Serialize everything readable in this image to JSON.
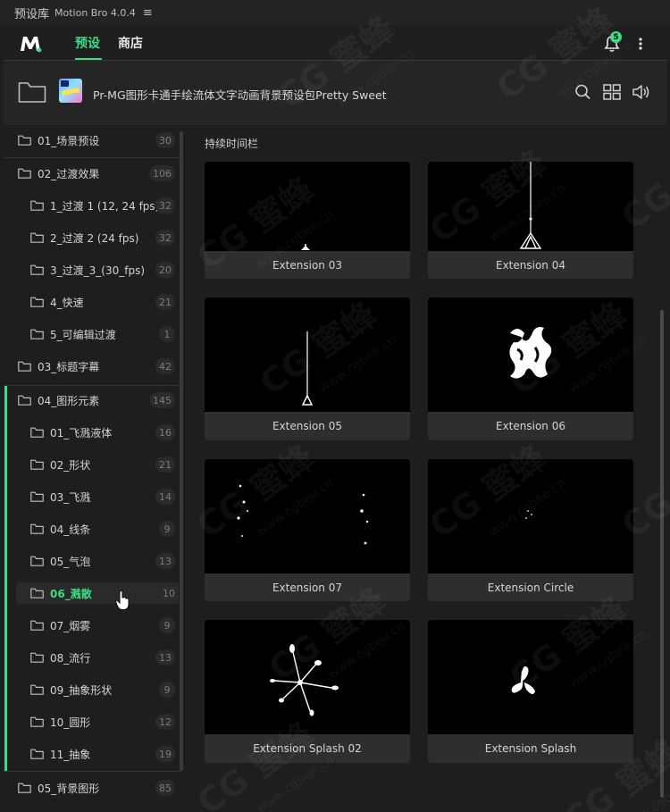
{
  "titlebar": {
    "name": "预设库",
    "version": "Motion Bro 4.0.4",
    "menu_glyph": "≡"
  },
  "header": {
    "tabs": [
      {
        "label": "预设"
      },
      {
        "label": "商店"
      }
    ],
    "notification_count": "5",
    "accent": "#3ddc84"
  },
  "pack": {
    "title": "Pr-MG图形卡通手绘流体文字动画背景预设包Pretty Sweet"
  },
  "sidebar": {
    "items": [
      {
        "label": "01_场景预设",
        "count": "30"
      },
      {
        "label": "02_过渡效果",
        "count": "106"
      },
      {
        "label": "1_过渡 1 (12, 24 fps)",
        "count": "32"
      },
      {
        "label": "2_过渡 2 (24 fps)",
        "count": "32"
      },
      {
        "label": "3_过渡_3_(30_fps)",
        "count": "20"
      },
      {
        "label": "4_快速",
        "count": "21"
      },
      {
        "label": "5_可编辑过渡",
        "count": "1"
      },
      {
        "label": "03_标题字幕",
        "count": "42"
      },
      {
        "label": "04_图形元素",
        "count": "145"
      },
      {
        "label": "01_飞溅液体",
        "count": "16"
      },
      {
        "label": "02_形状",
        "count": "21"
      },
      {
        "label": "03_飞溅",
        "count": "14"
      },
      {
        "label": "04_线条",
        "count": "9"
      },
      {
        "label": "05_气泡",
        "count": "13"
      },
      {
        "label": "06_溅散",
        "count": "10"
      },
      {
        "label": "07_烟雾",
        "count": "9"
      },
      {
        "label": "08_流行",
        "count": "13"
      },
      {
        "label": "09_抽象形状",
        "count": "9"
      },
      {
        "label": "10_圆形",
        "count": "12"
      },
      {
        "label": "11_抽象",
        "count": "19"
      },
      {
        "label": "05_背景图形",
        "count": "85"
      }
    ]
  },
  "main": {
    "section_title": "持续时间栏",
    "cards": [
      {
        "label": "Extension 03"
      },
      {
        "label": "Extension 04"
      },
      {
        "label": "Extension 05"
      },
      {
        "label": "Extension 06"
      },
      {
        "label": "Extension 07"
      },
      {
        "label": "Extension Circle"
      },
      {
        "label": "Extension Splash 02"
      },
      {
        "label": "Extension Splash"
      }
    ]
  },
  "watermark": {
    "brand": "CG 蜜蜂",
    "url": "www.cgbee.cn"
  }
}
